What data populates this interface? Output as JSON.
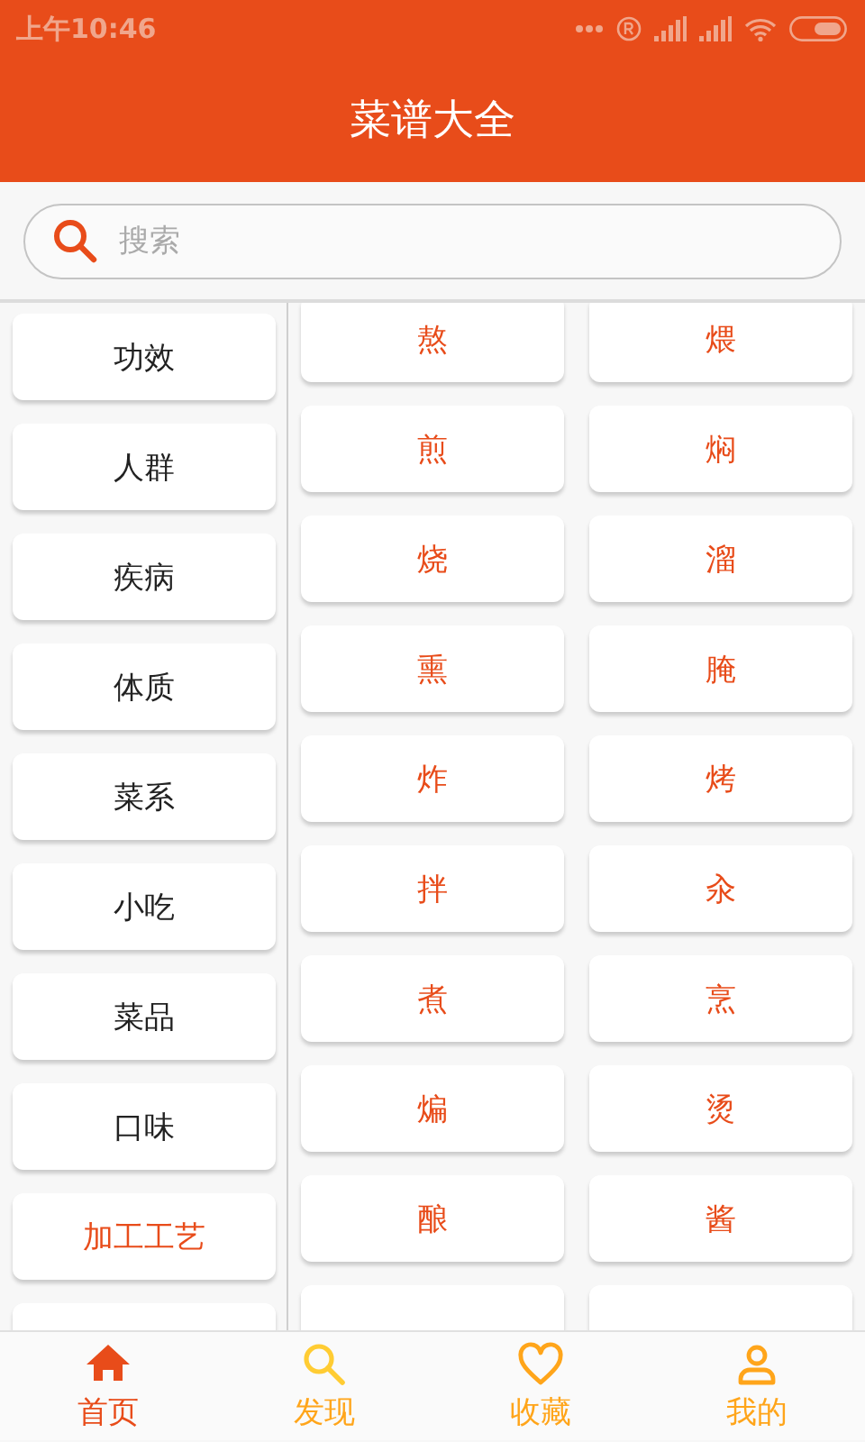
{
  "status_bar": {
    "time": "上午10:46"
  },
  "header": {
    "title": "菜谱大全"
  },
  "search": {
    "placeholder": "搜索"
  },
  "categories": [
    {
      "label": "功效",
      "selected": false
    },
    {
      "label": "人群",
      "selected": false
    },
    {
      "label": "疾病",
      "selected": false
    },
    {
      "label": "体质",
      "selected": false
    },
    {
      "label": "菜系",
      "selected": false
    },
    {
      "label": "小吃",
      "selected": false
    },
    {
      "label": "菜品",
      "selected": false
    },
    {
      "label": "口味",
      "selected": false
    },
    {
      "label": "加工工艺",
      "selected": true
    }
  ],
  "methods": [
    "熬",
    "煨",
    "煎",
    "焖",
    "烧",
    "溜",
    "熏",
    "腌",
    "炸",
    "烤",
    "拌",
    "汆",
    "煮",
    "烹",
    "煸",
    "烫",
    "酿",
    "酱"
  ],
  "tab_bar": [
    {
      "label": "首页",
      "kind": "home",
      "selected": true
    },
    {
      "label": "发现",
      "kind": "search",
      "selected": false
    },
    {
      "label": "收藏",
      "kind": "heart",
      "selected": false
    },
    {
      "label": "我的",
      "kind": "person",
      "selected": false
    }
  ]
}
